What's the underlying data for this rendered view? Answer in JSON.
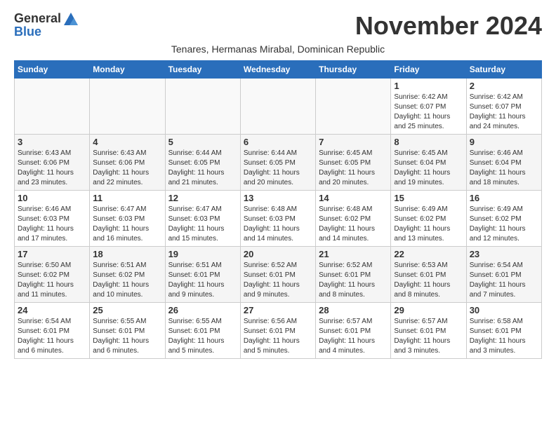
{
  "header": {
    "logo_general": "General",
    "logo_blue": "Blue",
    "month_title": "November 2024",
    "subtitle": "Tenares, Hermanas Mirabal, Dominican Republic"
  },
  "weekdays": [
    "Sunday",
    "Monday",
    "Tuesday",
    "Wednesday",
    "Thursday",
    "Friday",
    "Saturday"
  ],
  "weeks": [
    [
      {
        "day": "",
        "sunrise": "",
        "sunset": "",
        "daylight": "",
        "empty": true
      },
      {
        "day": "",
        "sunrise": "",
        "sunset": "",
        "daylight": "",
        "empty": true
      },
      {
        "day": "",
        "sunrise": "",
        "sunset": "",
        "daylight": "",
        "empty": true
      },
      {
        "day": "",
        "sunrise": "",
        "sunset": "",
        "daylight": "",
        "empty": true
      },
      {
        "day": "",
        "sunrise": "",
        "sunset": "",
        "daylight": "",
        "empty": true
      },
      {
        "day": "1",
        "sunrise": "Sunrise: 6:42 AM",
        "sunset": "Sunset: 6:07 PM",
        "daylight": "Daylight: 11 hours and 25 minutes.",
        "empty": false
      },
      {
        "day": "2",
        "sunrise": "Sunrise: 6:42 AM",
        "sunset": "Sunset: 6:07 PM",
        "daylight": "Daylight: 11 hours and 24 minutes.",
        "empty": false
      }
    ],
    [
      {
        "day": "3",
        "sunrise": "Sunrise: 6:43 AM",
        "sunset": "Sunset: 6:06 PM",
        "daylight": "Daylight: 11 hours and 23 minutes.",
        "empty": false
      },
      {
        "day": "4",
        "sunrise": "Sunrise: 6:43 AM",
        "sunset": "Sunset: 6:06 PM",
        "daylight": "Daylight: 11 hours and 22 minutes.",
        "empty": false
      },
      {
        "day": "5",
        "sunrise": "Sunrise: 6:44 AM",
        "sunset": "Sunset: 6:05 PM",
        "daylight": "Daylight: 11 hours and 21 minutes.",
        "empty": false
      },
      {
        "day": "6",
        "sunrise": "Sunrise: 6:44 AM",
        "sunset": "Sunset: 6:05 PM",
        "daylight": "Daylight: 11 hours and 20 minutes.",
        "empty": false
      },
      {
        "day": "7",
        "sunrise": "Sunrise: 6:45 AM",
        "sunset": "Sunset: 6:05 PM",
        "daylight": "Daylight: 11 hours and 20 minutes.",
        "empty": false
      },
      {
        "day": "8",
        "sunrise": "Sunrise: 6:45 AM",
        "sunset": "Sunset: 6:04 PM",
        "daylight": "Daylight: 11 hours and 19 minutes.",
        "empty": false
      },
      {
        "day": "9",
        "sunrise": "Sunrise: 6:46 AM",
        "sunset": "Sunset: 6:04 PM",
        "daylight": "Daylight: 11 hours and 18 minutes.",
        "empty": false
      }
    ],
    [
      {
        "day": "10",
        "sunrise": "Sunrise: 6:46 AM",
        "sunset": "Sunset: 6:03 PM",
        "daylight": "Daylight: 11 hours and 17 minutes.",
        "empty": false
      },
      {
        "day": "11",
        "sunrise": "Sunrise: 6:47 AM",
        "sunset": "Sunset: 6:03 PM",
        "daylight": "Daylight: 11 hours and 16 minutes.",
        "empty": false
      },
      {
        "day": "12",
        "sunrise": "Sunrise: 6:47 AM",
        "sunset": "Sunset: 6:03 PM",
        "daylight": "Daylight: 11 hours and 15 minutes.",
        "empty": false
      },
      {
        "day": "13",
        "sunrise": "Sunrise: 6:48 AM",
        "sunset": "Sunset: 6:03 PM",
        "daylight": "Daylight: 11 hours and 14 minutes.",
        "empty": false
      },
      {
        "day": "14",
        "sunrise": "Sunrise: 6:48 AM",
        "sunset": "Sunset: 6:02 PM",
        "daylight": "Daylight: 11 hours and 14 minutes.",
        "empty": false
      },
      {
        "day": "15",
        "sunrise": "Sunrise: 6:49 AM",
        "sunset": "Sunset: 6:02 PM",
        "daylight": "Daylight: 11 hours and 13 minutes.",
        "empty": false
      },
      {
        "day": "16",
        "sunrise": "Sunrise: 6:49 AM",
        "sunset": "Sunset: 6:02 PM",
        "daylight": "Daylight: 11 hours and 12 minutes.",
        "empty": false
      }
    ],
    [
      {
        "day": "17",
        "sunrise": "Sunrise: 6:50 AM",
        "sunset": "Sunset: 6:02 PM",
        "daylight": "Daylight: 11 hours and 11 minutes.",
        "empty": false
      },
      {
        "day": "18",
        "sunrise": "Sunrise: 6:51 AM",
        "sunset": "Sunset: 6:02 PM",
        "daylight": "Daylight: 11 hours and 10 minutes.",
        "empty": false
      },
      {
        "day": "19",
        "sunrise": "Sunrise: 6:51 AM",
        "sunset": "Sunset: 6:01 PM",
        "daylight": "Daylight: 11 hours and 9 minutes.",
        "empty": false
      },
      {
        "day": "20",
        "sunrise": "Sunrise: 6:52 AM",
        "sunset": "Sunset: 6:01 PM",
        "daylight": "Daylight: 11 hours and 9 minutes.",
        "empty": false
      },
      {
        "day": "21",
        "sunrise": "Sunrise: 6:52 AM",
        "sunset": "Sunset: 6:01 PM",
        "daylight": "Daylight: 11 hours and 8 minutes.",
        "empty": false
      },
      {
        "day": "22",
        "sunrise": "Sunrise: 6:53 AM",
        "sunset": "Sunset: 6:01 PM",
        "daylight": "Daylight: 11 hours and 8 minutes.",
        "empty": false
      },
      {
        "day": "23",
        "sunrise": "Sunrise: 6:54 AM",
        "sunset": "Sunset: 6:01 PM",
        "daylight": "Daylight: 11 hours and 7 minutes.",
        "empty": false
      }
    ],
    [
      {
        "day": "24",
        "sunrise": "Sunrise: 6:54 AM",
        "sunset": "Sunset: 6:01 PM",
        "daylight": "Daylight: 11 hours and 6 minutes.",
        "empty": false
      },
      {
        "day": "25",
        "sunrise": "Sunrise: 6:55 AM",
        "sunset": "Sunset: 6:01 PM",
        "daylight": "Daylight: 11 hours and 6 minutes.",
        "empty": false
      },
      {
        "day": "26",
        "sunrise": "Sunrise: 6:55 AM",
        "sunset": "Sunset: 6:01 PM",
        "daylight": "Daylight: 11 hours and 5 minutes.",
        "empty": false
      },
      {
        "day": "27",
        "sunrise": "Sunrise: 6:56 AM",
        "sunset": "Sunset: 6:01 PM",
        "daylight": "Daylight: 11 hours and 5 minutes.",
        "empty": false
      },
      {
        "day": "28",
        "sunrise": "Sunrise: 6:57 AM",
        "sunset": "Sunset: 6:01 PM",
        "daylight": "Daylight: 11 hours and 4 minutes.",
        "empty": false
      },
      {
        "day": "29",
        "sunrise": "Sunrise: 6:57 AM",
        "sunset": "Sunset: 6:01 PM",
        "daylight": "Daylight: 11 hours and 3 minutes.",
        "empty": false
      },
      {
        "day": "30",
        "sunrise": "Sunrise: 6:58 AM",
        "sunset": "Sunset: 6:01 PM",
        "daylight": "Daylight: 11 hours and 3 minutes.",
        "empty": false
      }
    ]
  ]
}
